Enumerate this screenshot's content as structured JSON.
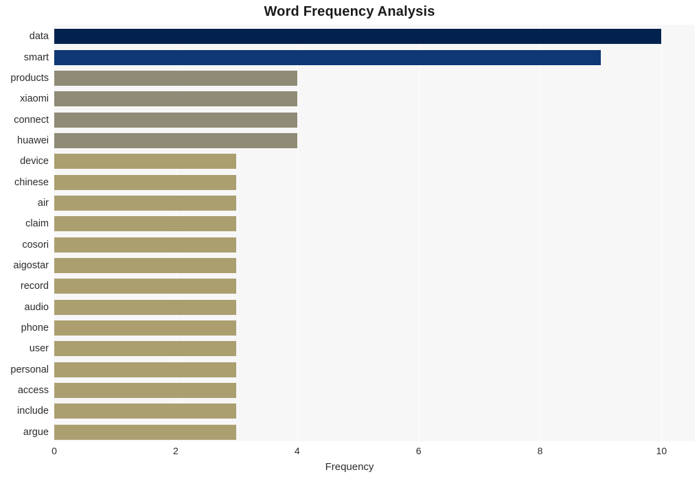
{
  "chart_data": {
    "type": "bar",
    "orientation": "horizontal",
    "title": "Word Frequency Analysis",
    "xlabel": "Frequency",
    "ylabel": "",
    "xlim": [
      0,
      10.55
    ],
    "xticks": [
      0,
      2,
      4,
      6,
      8,
      10
    ],
    "xtick_labels": [
      "0",
      "2",
      "4",
      "6",
      "8",
      "10"
    ],
    "grid": "vertical-white-on-light-panel",
    "legend": "none",
    "categories": [
      "data",
      "smart",
      "products",
      "xiaomi",
      "connect",
      "huawei",
      "device",
      "chinese",
      "air",
      "claim",
      "cosori",
      "aigostar",
      "record",
      "audio",
      "phone",
      "user",
      "personal",
      "access",
      "include",
      "argue"
    ],
    "values": [
      10,
      9,
      4,
      4,
      4,
      4,
      3,
      3,
      3,
      3,
      3,
      3,
      3,
      3,
      3,
      3,
      3,
      3,
      3,
      3
    ],
    "bar_colors": [
      "#02224d",
      "#0d3873",
      "#908b76",
      "#908b76",
      "#908b76",
      "#908b76",
      "#ab9f70",
      "#ab9f70",
      "#ab9f70",
      "#ab9f70",
      "#ab9f70",
      "#ab9f70",
      "#ab9f70",
      "#ab9f70",
      "#ab9f70",
      "#ab9f70",
      "#ab9f70",
      "#ab9f70",
      "#ab9f70",
      "#ab9f70"
    ],
    "panel_background": "#f7f7f8",
    "figure_background": "#ffffff",
    "gridline_color": "#ffffff",
    "text_color": "#2b2b2b"
  }
}
